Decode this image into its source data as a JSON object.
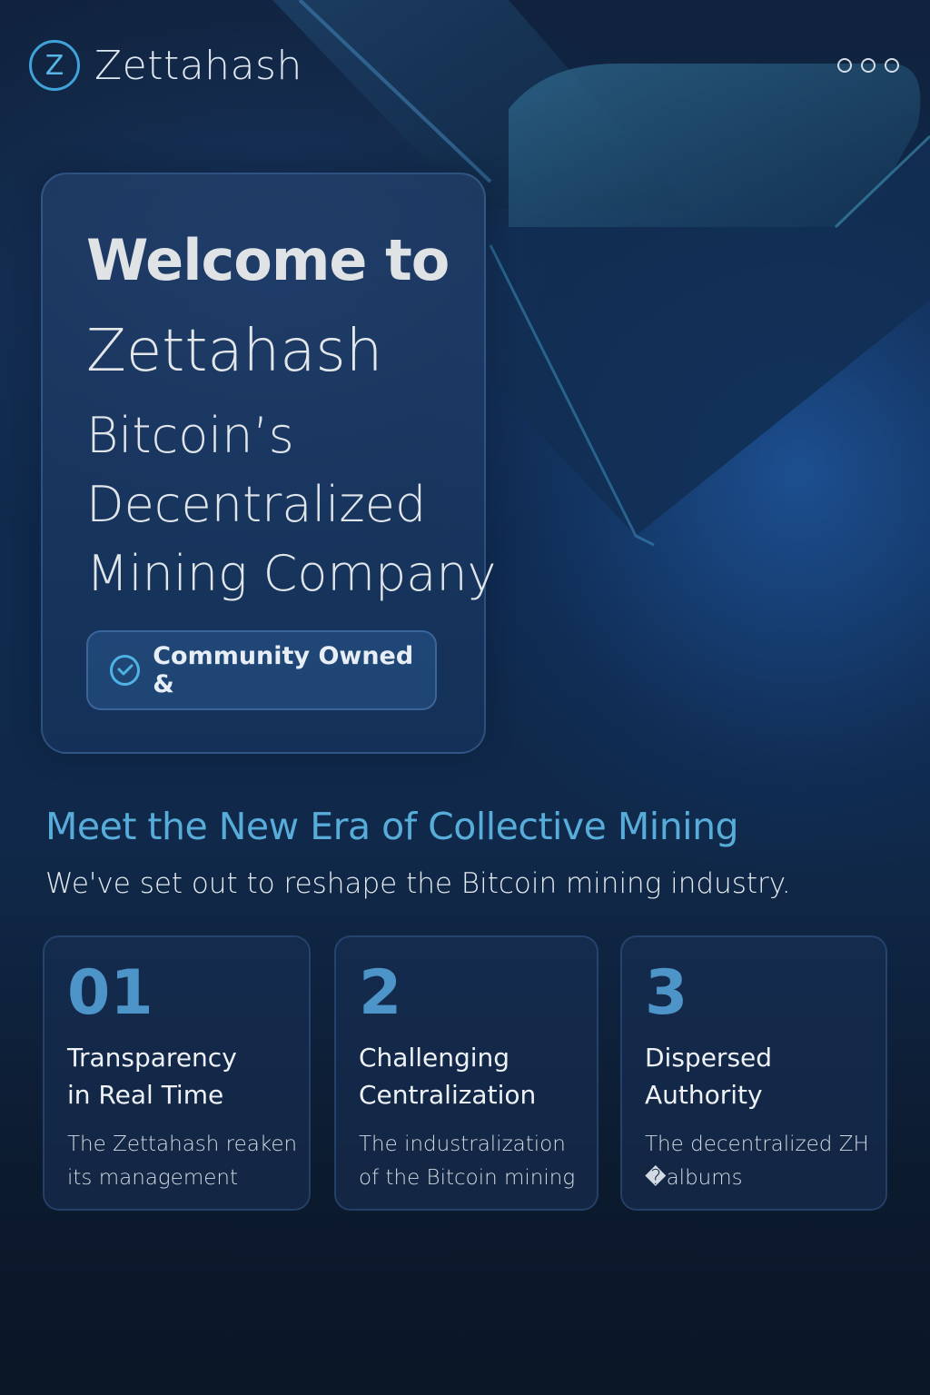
{
  "brand": {
    "logo_letter": "Z",
    "name": "Zettahash"
  },
  "hero": {
    "title": "Welcome to",
    "brand": "Zettahash",
    "subtitle_lines": [
      "Bitcoin’s",
      "Decentralized",
      "Mining Company"
    ],
    "badge_label": "Community Owned &"
  },
  "section": {
    "title": "Meet the New Era of Collective Mining",
    "subtitle": "We've set out to reshape the Bitcoin mining industry."
  },
  "features": [
    {
      "number": "01",
      "title_lines": [
        "Transparency",
        "in Real Time"
      ],
      "desc_lines": [
        "The Zettahash reaken",
        "its management"
      ]
    },
    {
      "number": "2",
      "title_lines": [
        "Challenging",
        "Centralization"
      ],
      "desc_lines": [
        "The industralization",
        "of the Bitcoin mining"
      ]
    },
    {
      "number": "3",
      "title_lines": [
        "Dispersed",
        "Authority"
      ],
      "desc_lines": [
        "The decentralized ZH",
        "�albums"
      ]
    }
  ],
  "colors": {
    "accent": "#58acd9",
    "background": "#0c1a2e",
    "number": "#4d94c8"
  },
  "icons": [
    "logo-z-icon",
    "more-dots-icon",
    "check-circle-icon"
  ]
}
